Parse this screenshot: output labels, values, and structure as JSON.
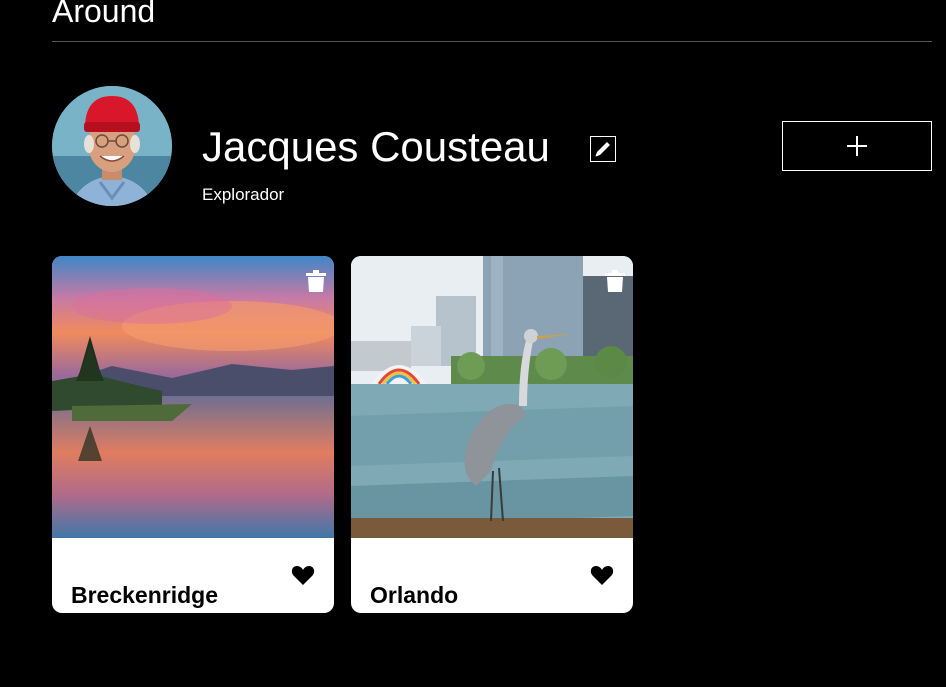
{
  "header": {
    "logo_text": "Around"
  },
  "profile": {
    "name": "Jacques Cousteau",
    "about": "Explorador",
    "avatar_icon": "avatar-photo",
    "edit_icon": "pencil-icon"
  },
  "actions": {
    "add_icon": "plus-icon"
  },
  "cards": [
    {
      "title": "Breckenridge",
      "liked": true,
      "image": "sunset-lake-photo"
    },
    {
      "title": "Orlando",
      "liked": true,
      "image": "heron-lake-city-photo"
    }
  ],
  "colors": {
    "background": "#000000",
    "card_background": "#ffffff",
    "text_primary": "#ffffff",
    "divider": "#545454"
  }
}
